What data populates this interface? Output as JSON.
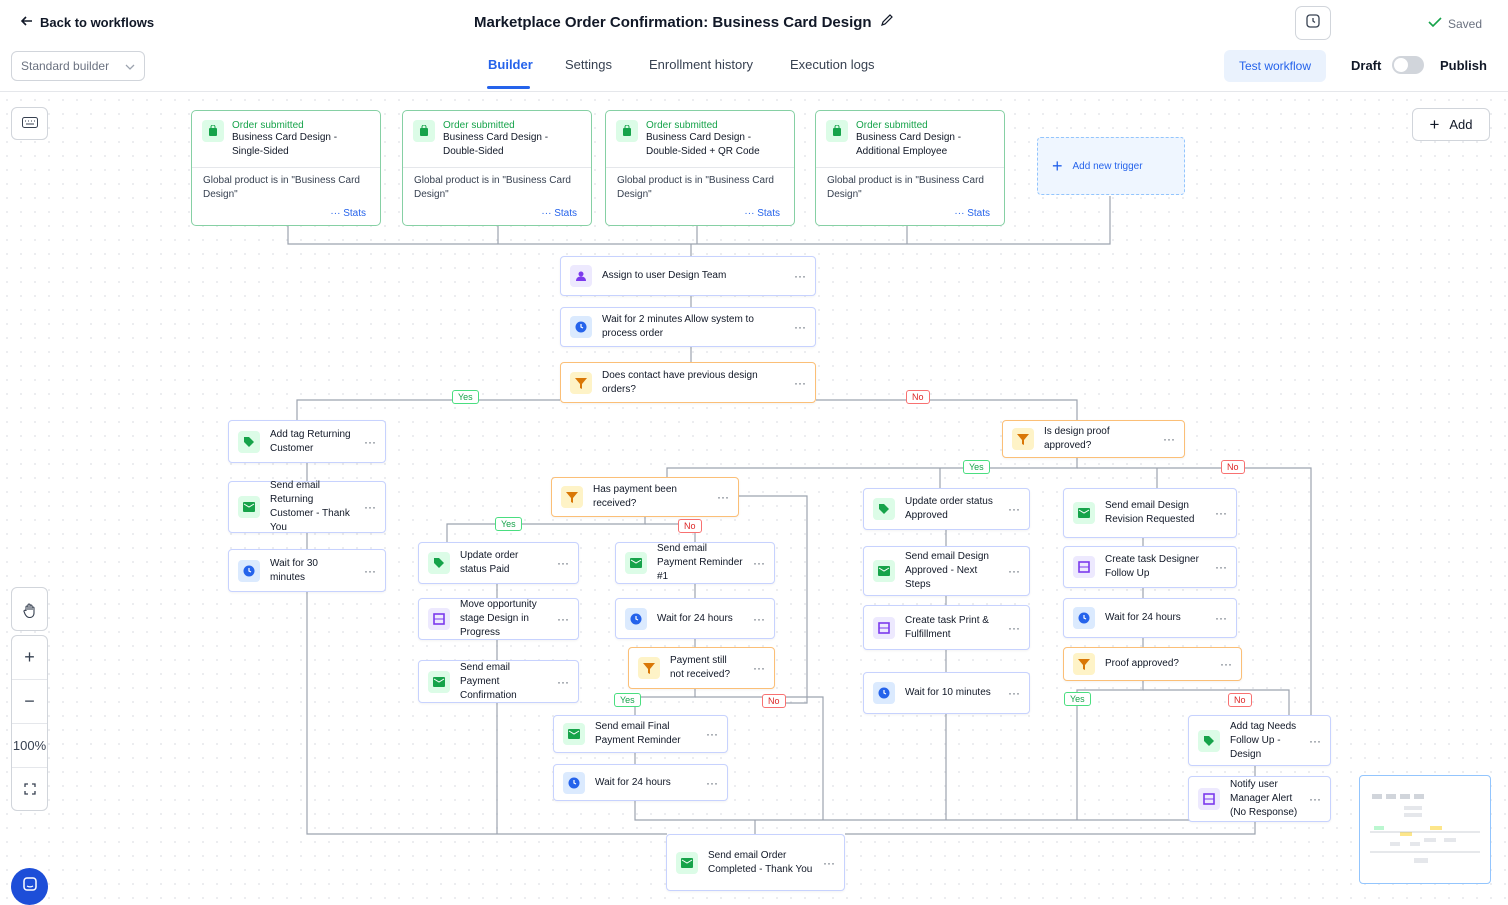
{
  "header": {
    "back_label": "Back to workflows",
    "title": "Marketplace Order Confirmation: Business Card Design",
    "saved_label": "Saved",
    "builder_select": "Standard builder",
    "tabs": [
      {
        "label": "Builder"
      },
      {
        "label": "Settings"
      },
      {
        "label": "Enrollment history"
      },
      {
        "label": "Execution logs"
      }
    ],
    "test_label": "Test workflow",
    "draft_label": "Draft",
    "publish_label": "Publish"
  },
  "triggers": [
    {
      "type": "Order submitted",
      "name": "Business Card Design - Single-Sided",
      "filter": "Global product is in \"Business Card Design\"",
      "stats": "Stats"
    },
    {
      "type": "Order submitted",
      "name": "Business Card Design - Double-Sided",
      "filter": "Global product is in \"Business Card Design\"",
      "stats": "Stats"
    },
    {
      "type": "Order submitted",
      "name": "Business Card Design - Double-Sided + QR Code",
      "filter": "Global product is in \"Business Card Design\"",
      "stats": "Stats"
    },
    {
      "type": "Order submitted",
      "name": "Business Card Design - Additional Employee",
      "filter": "Global product is in \"Business Card Design\"",
      "stats": "Stats"
    }
  ],
  "add_trigger_label": "Add new trigger",
  "add_label": "Add",
  "zoom": "100%",
  "nodes": {
    "assign": "Assign to user Design Team",
    "wait2": "Wait for 2 minutes Allow system to process order",
    "cond_prev": "Does contact have previous design orders?",
    "tag_returning": "Add tag Returning Customer",
    "email_returning": "Send email Returning Customer - Thank You",
    "wait30": "Wait for 30 minutes",
    "cond_payment": "Has payment been received?",
    "status_paid": "Update order status Paid",
    "move_stage": "Move opportunity stage Design in Progress",
    "email_payconf": "Send email Payment Confirmation",
    "email_payrem": "Send email Payment Reminder #1",
    "wait24a": "Wait for 24 hours",
    "cond_paystill": "Payment still not received?",
    "email_final": "Send email Final Payment Reminder",
    "wait24b": "Wait for 24 hours",
    "cond_proof": "Is design proof approved?",
    "status_approved": "Update order status Approved",
    "email_approved": "Send email Design Approved - Next Steps",
    "task_print": "Create task Print & Fulfillment",
    "wait10": "Wait for 10 minutes",
    "email_revision": "Send email Design Revision Requested",
    "task_designer": "Create task Designer Follow Up",
    "wait24c": "Wait for 24 hours",
    "cond_proof2": "Proof approved?",
    "tag_followup": "Add tag Needs Follow Up - Design",
    "notify_mgr": "Notify user Manager Alert (No Response)",
    "email_completed": "Send email Order Completed - Thank You"
  },
  "branch_labels": {
    "yes": "Yes",
    "no": "No"
  },
  "colors": {
    "accent": "#2563eb",
    "trigger_border": "#86d0a4",
    "condition_border": "#fbbf77"
  }
}
